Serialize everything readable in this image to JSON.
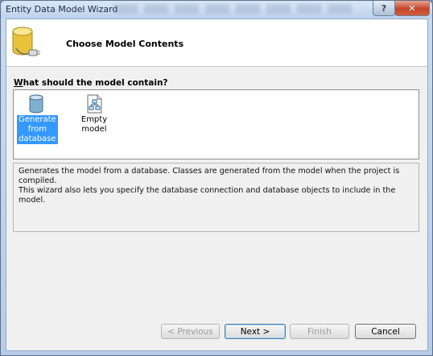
{
  "window": {
    "title": "Entity Data Model Wizard",
    "help_glyph": "?",
    "close_glyph": "✕"
  },
  "header": {
    "title": "Choose Model Contents",
    "icon": "database-wizard-icon"
  },
  "question": {
    "accel": "W",
    "rest": "hat should the model contain?"
  },
  "choices": [
    {
      "label_lines": [
        "Generate",
        "from",
        "database"
      ],
      "icon": "database-icon",
      "selected": true
    },
    {
      "label_lines": [
        "Empty model"
      ],
      "icon": "empty-model-icon",
      "selected": false
    }
  ],
  "description": {
    "line1": "Generates the model from a database. Classes are generated from the model when the project is compiled.",
    "line2": "This wizard also lets you specify the database connection and database objects to include in the model."
  },
  "buttons": {
    "previous": "< Previous",
    "next": "Next >",
    "finish": "Finish",
    "cancel": "Cancel"
  },
  "colors": {
    "selection": "#3399ff",
    "close_button": "#c5452a"
  }
}
